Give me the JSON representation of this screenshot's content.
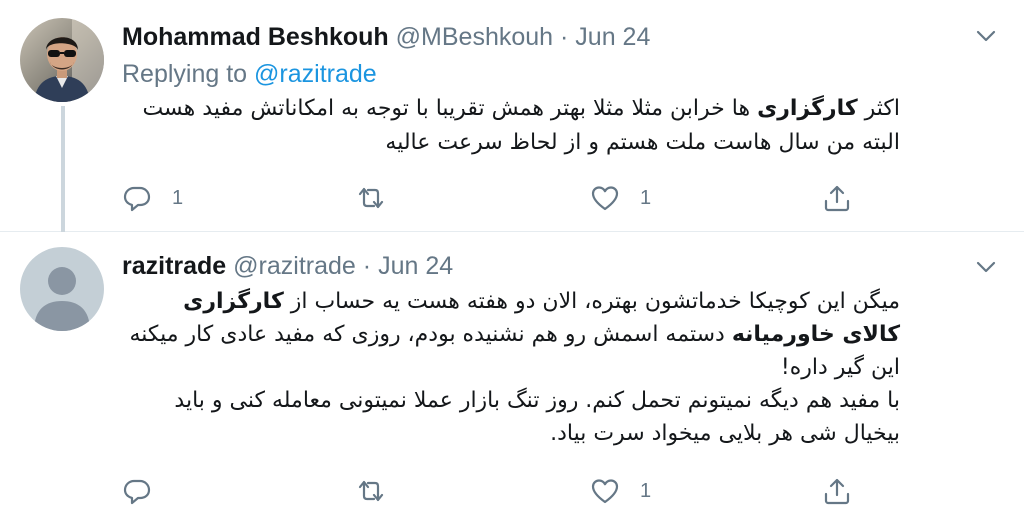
{
  "tweets": [
    {
      "author_name": "Mohammad Beshkouh",
      "handle": "@MBeshkouh",
      "separator": "·",
      "date": "Jun 24",
      "replying_to_label": "Replying to",
      "replying_to_handle": "@razitrade",
      "text_lines": [
        [
          "اکثر ",
          "کارگزاری",
          " ها خرابن مثلا مثلا بهتر همش تقریبا با توجه به امکاناتش مفید هست"
        ],
        [
          "البته من سال هاست ملت هستم و از لحاظ سرعت عالیه"
        ]
      ],
      "reply_count": "1",
      "retweet_count": "",
      "like_count": "1"
    },
    {
      "author_name": "razitrade",
      "handle": "@razitrade",
      "separator": "·",
      "date": "Jun 24",
      "text_lines": [
        [
          "میگن این کوچیکا خدماتشون بهتره، الان دو هفته هست یه حساب از ",
          "کارگزاری کالای خاورمیانه",
          " دستمه اسمش رو هم نشنیده بودم، روزی که مفید عادی کار میکنه این گیر داره!"
        ],
        [
          "با مفید هم دیگه نمیتونم تحمل کنم. روز تنگ بازار عملا نمیتونی معامله کنی و باید بیخیال شی هر بلایی میخواد سرت بیاد."
        ]
      ],
      "reply_count": "",
      "retweet_count": "",
      "like_count": "1"
    }
  ],
  "icons": {
    "reply": "reply-icon",
    "retweet": "retweet-icon",
    "like": "heart-icon",
    "share": "share-icon",
    "more": "chevron-down-icon"
  },
  "colors": {
    "text": "#14171a",
    "secondary": "#657786",
    "link": "#1b95e0",
    "thread_line": "#ccd6dd",
    "divider": "#e6ecf0"
  }
}
